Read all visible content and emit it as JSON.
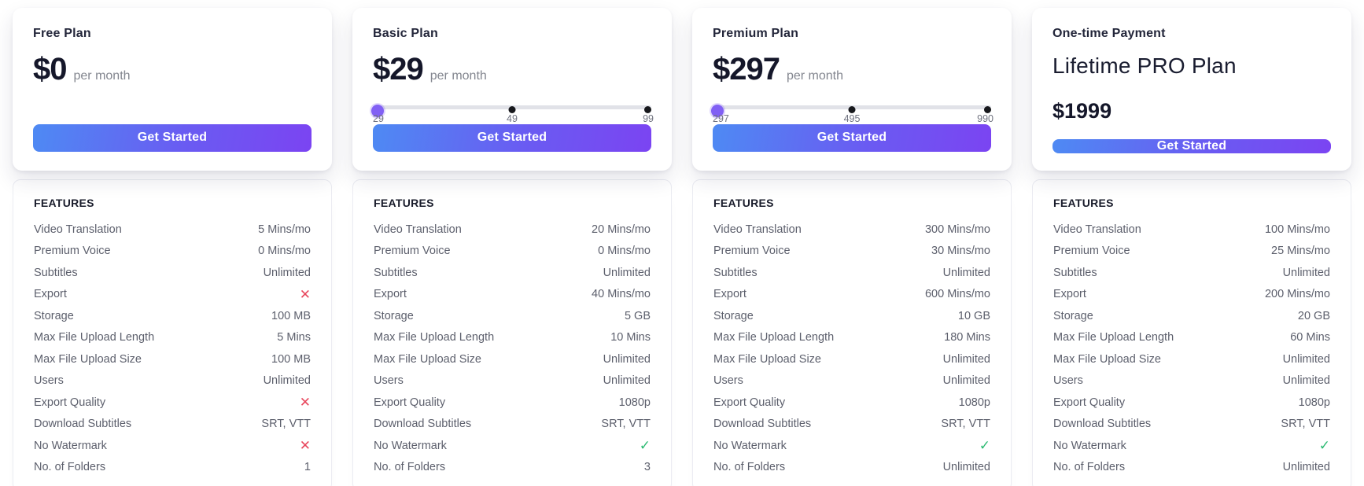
{
  "colors": {
    "button_gradient_start": "#4e8af3",
    "button_gradient_end": "#7b44f2",
    "slider_thumb": "#8160f4",
    "slider_track": "#e1e2e8",
    "cross": "#e8485e",
    "check": "#2cba72"
  },
  "icons": {
    "cross": "✕",
    "check": "✓"
  },
  "plans": [
    {
      "title": "Free Plan",
      "price": "$0",
      "period": "per month",
      "slider": null,
      "cta_label": "Get Started",
      "features_heading": "FEATURES",
      "features": [
        {
          "label": "Video Translation",
          "type": "text",
          "value": "5 Mins/mo"
        },
        {
          "label": "Premium Voice",
          "type": "text",
          "value": "0 Mins/mo"
        },
        {
          "label": "Subtitles",
          "type": "text",
          "value": "Unlimited"
        },
        {
          "label": "Export",
          "type": "cross",
          "value": "cross-icon"
        },
        {
          "label": "Storage",
          "type": "text",
          "value": "100 MB"
        },
        {
          "label": "Max File Upload Length",
          "type": "text",
          "value": "5 Mins"
        },
        {
          "label": "Max File Upload Size",
          "type": "text",
          "value": "100 MB"
        },
        {
          "label": "Users",
          "type": "text",
          "value": "Unlimited"
        },
        {
          "label": "Export Quality",
          "type": "cross",
          "value": "cross-icon"
        },
        {
          "label": "Download Subtitles",
          "type": "text",
          "value": "SRT, VTT"
        },
        {
          "label": "No Watermark",
          "type": "cross",
          "value": "cross-icon"
        },
        {
          "label": "No. of Folders",
          "type": "text",
          "value": "1"
        }
      ]
    },
    {
      "title": "Basic Plan",
      "price": "$29",
      "period": "per month",
      "slider": {
        "marks": [
          "29",
          "49",
          "99"
        ],
        "thumb_at": "29"
      },
      "cta_label": "Get Started",
      "features_heading": "FEATURES",
      "features": [
        {
          "label": "Video Translation",
          "type": "text",
          "value": "20 Mins/mo"
        },
        {
          "label": "Premium Voice",
          "type": "text",
          "value": "0 Mins/mo"
        },
        {
          "label": "Subtitles",
          "type": "text",
          "value": "Unlimited"
        },
        {
          "label": "Export",
          "type": "text",
          "value": "40 Mins/mo"
        },
        {
          "label": "Storage",
          "type": "text",
          "value": "5 GB"
        },
        {
          "label": "Max File Upload Length",
          "type": "text",
          "value": "10 Mins"
        },
        {
          "label": "Max File Upload Size",
          "type": "text",
          "value": "Unlimited"
        },
        {
          "label": "Users",
          "type": "text",
          "value": "Unlimited"
        },
        {
          "label": "Export Quality",
          "type": "text",
          "value": "1080p"
        },
        {
          "label": "Download Subtitles",
          "type": "text",
          "value": "SRT, VTT"
        },
        {
          "label": "No Watermark",
          "type": "check",
          "value": "check-icon"
        },
        {
          "label": "No. of Folders",
          "type": "text",
          "value": "3"
        }
      ]
    },
    {
      "title": "Premium Plan",
      "price": "$297",
      "period": "per month",
      "slider": {
        "marks": [
          "297",
          "495",
          "990"
        ],
        "thumb_at": "297"
      },
      "cta_label": "Get Started",
      "features_heading": "FEATURES",
      "features": [
        {
          "label": "Video Translation",
          "type": "text",
          "value": "300 Mins/mo"
        },
        {
          "label": "Premium Voice",
          "type": "text",
          "value": "30 Mins/mo"
        },
        {
          "label": "Subtitles",
          "type": "text",
          "value": "Unlimited"
        },
        {
          "label": "Export",
          "type": "text",
          "value": "600 Mins/mo"
        },
        {
          "label": "Storage",
          "type": "text",
          "value": "10 GB"
        },
        {
          "label": "Max File Upload Length",
          "type": "text",
          "value": "180 Mins"
        },
        {
          "label": "Max File Upload Size",
          "type": "text",
          "value": "Unlimited"
        },
        {
          "label": "Users",
          "type": "text",
          "value": "Unlimited"
        },
        {
          "label": "Export Quality",
          "type": "text",
          "value": "1080p"
        },
        {
          "label": "Download Subtitles",
          "type": "text",
          "value": "SRT, VTT"
        },
        {
          "label": "No Watermark",
          "type": "check",
          "value": "check-icon"
        },
        {
          "label": "No. of Folders",
          "type": "text",
          "value": "Unlimited"
        }
      ]
    },
    {
      "title": "One-time Payment",
      "subtitle": "Lifetime PRO Plan",
      "price": "$1999",
      "period": "",
      "slider": null,
      "cta_label": "Get Started",
      "features_heading": "FEATURES",
      "features": [
        {
          "label": "Video Translation",
          "type": "text",
          "value": "100 Mins/mo"
        },
        {
          "label": "Premium Voice",
          "type": "text",
          "value": "25 Mins/mo"
        },
        {
          "label": "Subtitles",
          "type": "text",
          "value": "Unlimited"
        },
        {
          "label": "Export",
          "type": "text",
          "value": "200 Mins/mo"
        },
        {
          "label": "Storage",
          "type": "text",
          "value": "20 GB"
        },
        {
          "label": "Max File Upload Length",
          "type": "text",
          "value": "60 Mins"
        },
        {
          "label": "Max File Upload Size",
          "type": "text",
          "value": "Unlimited"
        },
        {
          "label": "Users",
          "type": "text",
          "value": "Unlimited"
        },
        {
          "label": "Export Quality",
          "type": "text",
          "value": "1080p"
        },
        {
          "label": "Download Subtitles",
          "type": "text",
          "value": "SRT, VTT"
        },
        {
          "label": "No Watermark",
          "type": "check",
          "value": "check-icon"
        },
        {
          "label": "No. of Folders",
          "type": "text",
          "value": "Unlimited"
        }
      ]
    }
  ]
}
